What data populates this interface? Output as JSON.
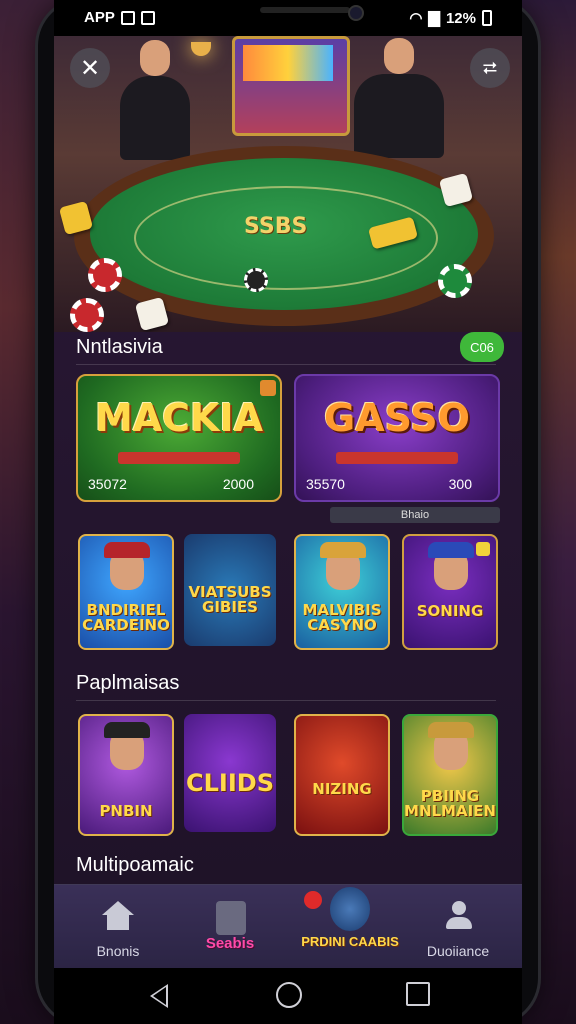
{
  "status_bar": {
    "app_label": "APP",
    "battery_text": "12%"
  },
  "hero": {
    "table_text": "SSBS",
    "close_icon": "close-icon",
    "share_icon": "share-icon"
  },
  "sections": {
    "featured_title": "Nntlasivia",
    "featured_badge": "C06",
    "popular_title": "Paplmaisas",
    "multiplayer_title": "Multipoamaic"
  },
  "featured_cards": [
    {
      "title": "MACKIA",
      "left_value": "35072",
      "right_value": "2000"
    },
    {
      "title": "GASSO",
      "left_value": "35570",
      "right_value": "300"
    }
  ],
  "filter_pill": "Bhaio",
  "row1_tiles": [
    {
      "title": "BNDIRIEL CARDEINO"
    },
    {
      "title": "VIATSUBS GIBIES"
    },
    {
      "title": "MALVIBIS CASYNO"
    },
    {
      "title": "SONING"
    }
  ],
  "row2_tiles": [
    {
      "title": "PNBIN"
    },
    {
      "title": "CLIIDS"
    },
    {
      "title": "NIZING"
    },
    {
      "title": "PBIING MNLMAIEN"
    }
  ],
  "bottom_nav": [
    {
      "label": "Bnonis",
      "icon": "home-icon"
    },
    {
      "label": "Seabis",
      "icon": "store-icon"
    },
    {
      "label": "PRDINI CAABIS",
      "icon": "promo-icon"
    },
    {
      "label": "Duoiiance",
      "icon": "profile-icon"
    }
  ],
  "colors": {
    "accent_green": "#3fb83a",
    "accent_gold": "#ffd94a",
    "background": "#24152e"
  }
}
